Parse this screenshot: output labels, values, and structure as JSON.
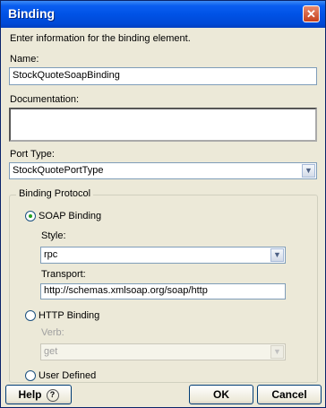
{
  "window": {
    "title": "Binding",
    "close_glyph": "✕"
  },
  "intro": "Enter information for the binding element.",
  "name": {
    "label": "Name:",
    "value": "StockQuoteSoapBinding"
  },
  "documentation": {
    "label": "Documentation:",
    "value": ""
  },
  "port_type": {
    "label": "Port Type:",
    "value": "StockQuotePortType"
  },
  "binding_protocol": {
    "label": "Binding Protocol",
    "soap": {
      "label": "SOAP Binding",
      "selected": true,
      "style_label": "Style:",
      "style_value": "rpc",
      "transport_label": "Transport:",
      "transport_value": "http://schemas.xmlsoap.org/soap/http"
    },
    "http": {
      "label": "HTTP Binding",
      "verb_label": "Verb:",
      "verb_value": "get"
    },
    "user_defined": {
      "label": "User Defined"
    }
  },
  "buttons": {
    "help": "Help",
    "help_icon": "?",
    "ok": "OK",
    "cancel": "Cancel"
  }
}
